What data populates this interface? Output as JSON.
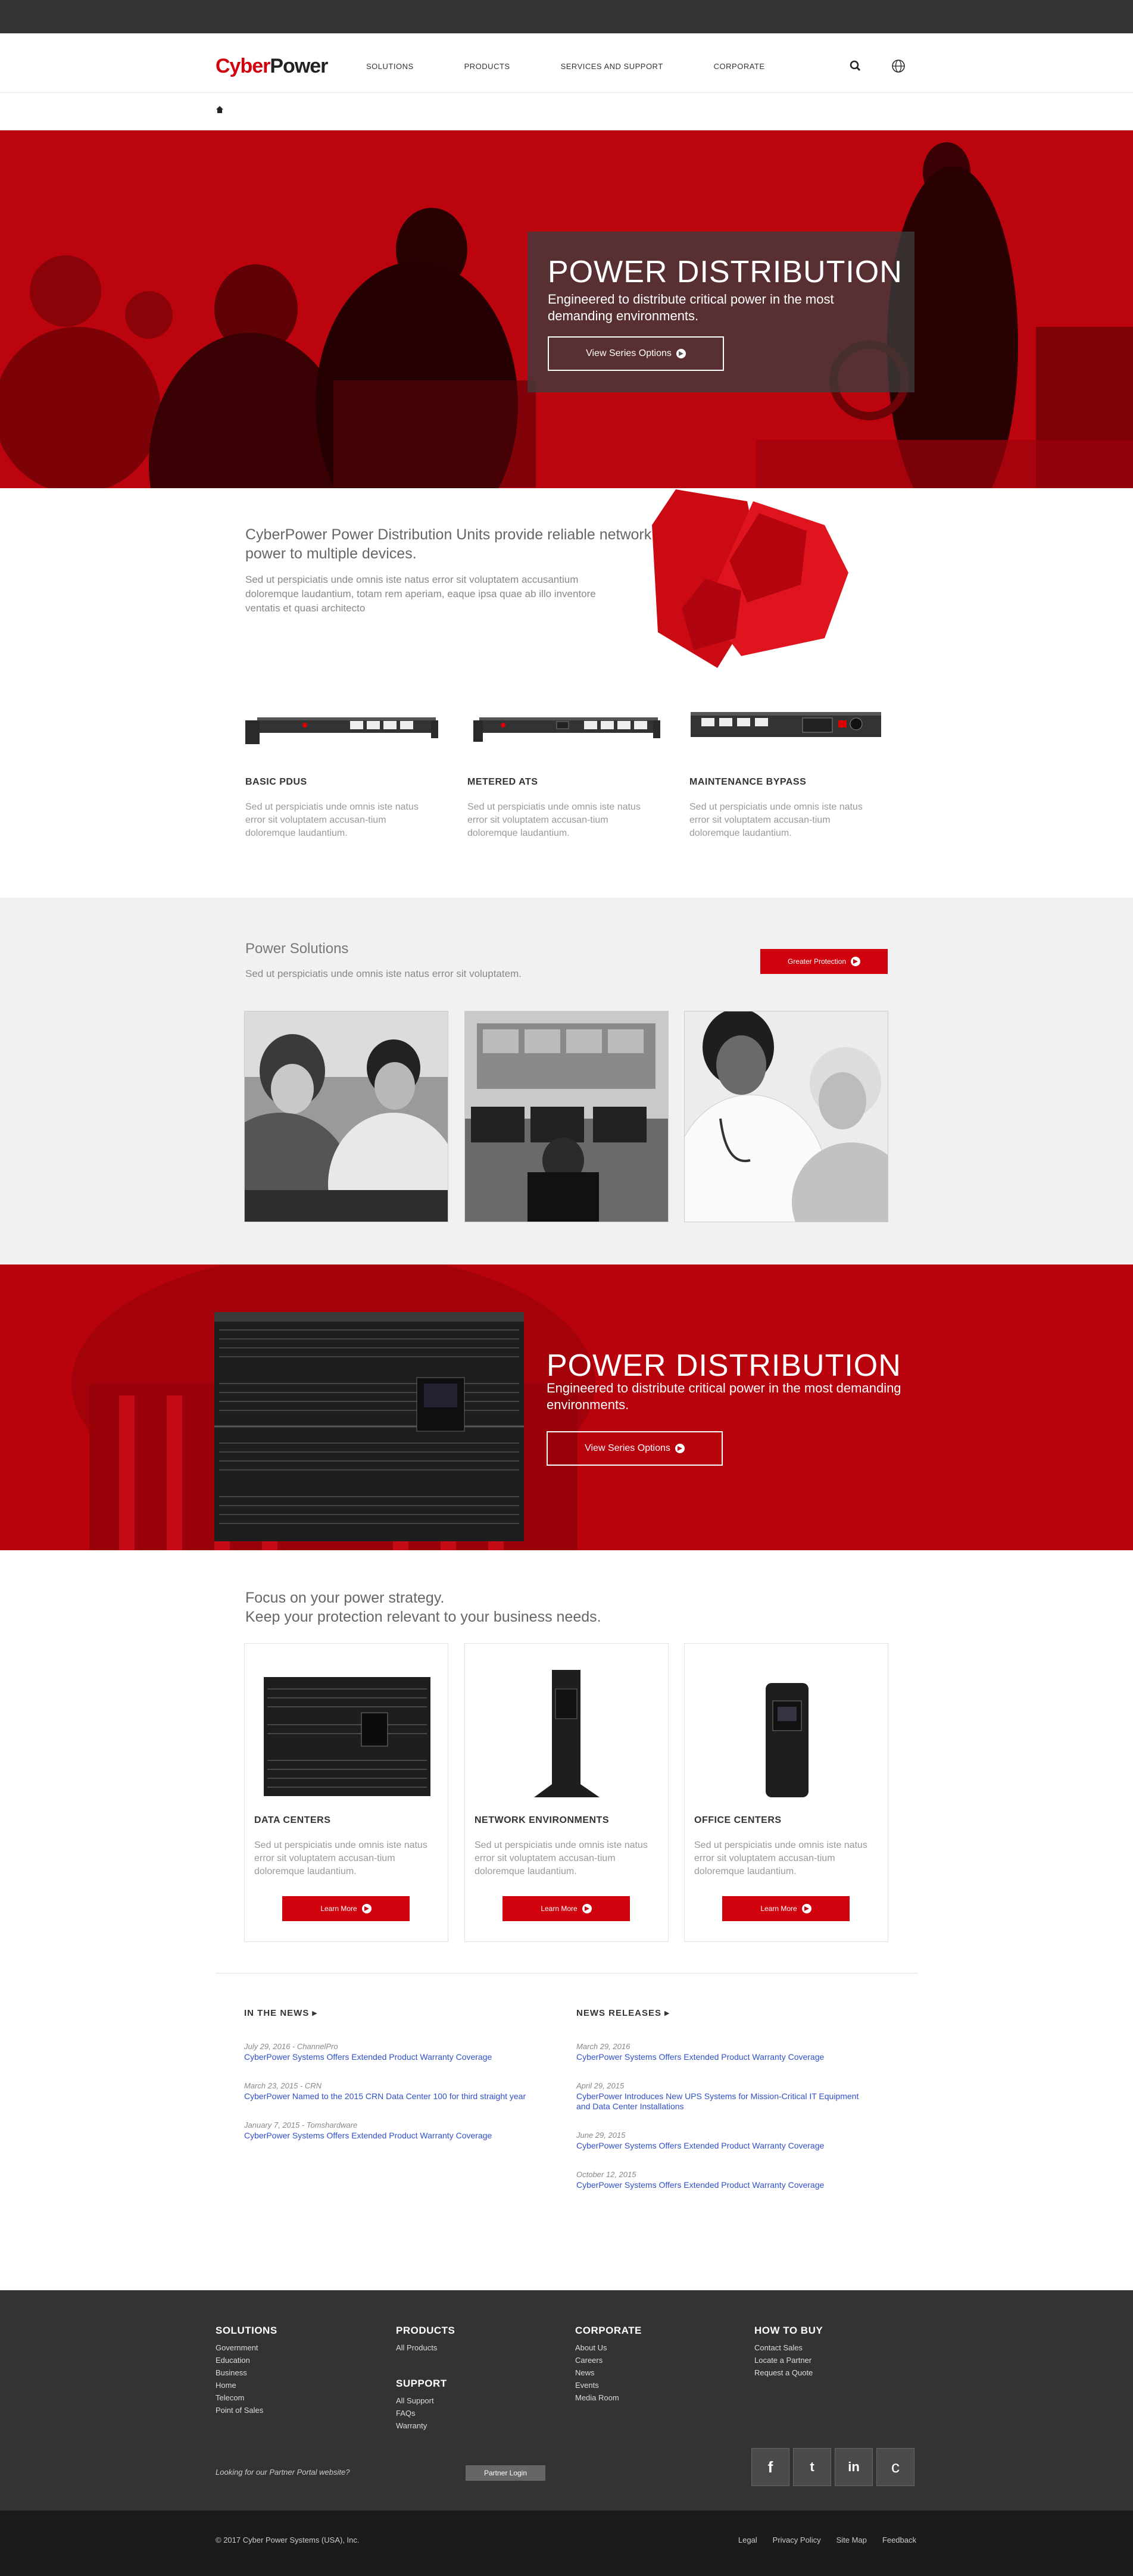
{
  "header": {
    "logo": {
      "part1": "Cyber",
      "part2": "Power"
    },
    "nav": [
      "SOLUTIONS",
      "PRODUCTS",
      "SERVICES AND SUPPORT",
      "CORPORATE"
    ]
  },
  "hero": {
    "title": "POWER DISTRIBUTION",
    "subtitle": "Engineered to distribute critical power in the most demanding environments.",
    "button": "View Series Options"
  },
  "intro": {
    "lead": "CyberPower Power Distribution Units provide reliable network power to multiple devices.",
    "body": "Sed ut perspiciatis unde omnis iste natus error sit voluptatem accusantium doloremque laudantium, totam rem aperiam, eaque ipsa quae ab illo inventore ventatis et quasi architecto"
  },
  "products": [
    {
      "title": "BASIC PDUS",
      "desc": "Sed ut perspiciatis unde omnis iste natus error sit voluptatem accusan-tium doloremque laudantium."
    },
    {
      "title": "METERED ATS",
      "desc": "Sed ut perspiciatis unde omnis iste natus error sit voluptatem accusan-tium doloremque laudantium."
    },
    {
      "title": "MAINTENANCE BYPASS",
      "desc": "Sed ut perspiciatis unde omnis iste natus error sit voluptatem accusan-tium doloremque laudantium."
    }
  ],
  "solutions": {
    "title": "Power Solutions",
    "subtitle": "Sed ut perspiciatis unde omnis iste natus error sit voluptatem.",
    "button": "Greater Protection"
  },
  "hero2": {
    "title": "POWER DISTRIBUTION",
    "subtitle": "Engineered to distribute critical power in the most demanding environments.",
    "button": "View Series Options"
  },
  "focus": {
    "line1": "Focus on your power strategy.",
    "line2": "Keep your protection relevant to your business needs.",
    "cards": [
      {
        "title": "DATA CENTERS",
        "desc": "Sed ut perspiciatis unde omnis iste natus error sit voluptatem accusan-tium doloremque laudantium.",
        "button": "Learn More"
      },
      {
        "title": "NETWORK ENVIRONMENTS",
        "desc": "Sed ut perspiciatis unde omnis iste natus error sit voluptatem accusan-tium doloremque laudantium.",
        "button": "Learn More"
      },
      {
        "title": "OFFICE CENTERS",
        "desc": "Sed ut perspiciatis unde omnis iste natus error sit voluptatem accusan-tium doloremque laudantium.",
        "button": "Learn More"
      }
    ]
  },
  "news": {
    "in_the_news": {
      "heading": "IN THE NEWS",
      "items": [
        {
          "date": "July 29, 2016 - ChannelPro",
          "title": "CyberPower Systems Offers Extended Product Warranty Coverage"
        },
        {
          "date": "March 23, 2015 - CRN",
          "title": "CyberPower Named to the 2015 CRN Data Center 100 for third straight year"
        },
        {
          "date": "January 7, 2015 - Tomshardware",
          "title": "CyberPower Systems Offers Extended Product Warranty Coverage"
        }
      ]
    },
    "releases": {
      "heading": "NEWS RELEASES",
      "items": [
        {
          "date": "March 29, 2016",
          "title": "CyberPower Systems Offers Extended Product Warranty Coverage"
        },
        {
          "date": "April 29, 2015",
          "title": "CyberPower Introduces New UPS Systems for Mission-Critical IT Equipment and Data Center Installations"
        },
        {
          "date": "June 29, 2015",
          "title": "CyberPower Systems Offers Extended Product Warranty Coverage"
        },
        {
          "date": "October 12, 2015",
          "title": "CyberPower Systems Offers Extended Product Warranty Coverage"
        }
      ]
    }
  },
  "footer": {
    "solutions": {
      "heading": "SOLUTIONS",
      "links": [
        "Government",
        "Education",
        "Business",
        "Home",
        "Telecom",
        "Point of Sales"
      ]
    },
    "products": {
      "heading": "PRODUCTS",
      "links": [
        "All Products"
      ]
    },
    "support": {
      "heading": "SUPPORT",
      "links": [
        "All Support",
        "FAQs",
        "Warranty"
      ]
    },
    "corporate": {
      "heading": "CORPORATE",
      "links": [
        "About Us",
        "Careers",
        "News",
        "Events",
        "Media Room"
      ]
    },
    "how_to_buy": {
      "heading": "HOW TO BUY",
      "links": [
        "Contact Sales",
        "Locate a Partner",
        "Request a Quote"
      ]
    },
    "partner_question": "Looking for our Partner Portal website?",
    "partner_button": "Partner Login",
    "social": [
      "f",
      "t",
      "in",
      "c"
    ],
    "copyright": "© 2017 Cyber Power Systems (USA), Inc.",
    "bottom_links": [
      "Legal",
      "Privacy Policy",
      "Site Map",
      "Feedback"
    ]
  },
  "colors": {
    "brand_red": "#d0020e",
    "dark": "#333333",
    "link_blue": "#3050c8"
  }
}
